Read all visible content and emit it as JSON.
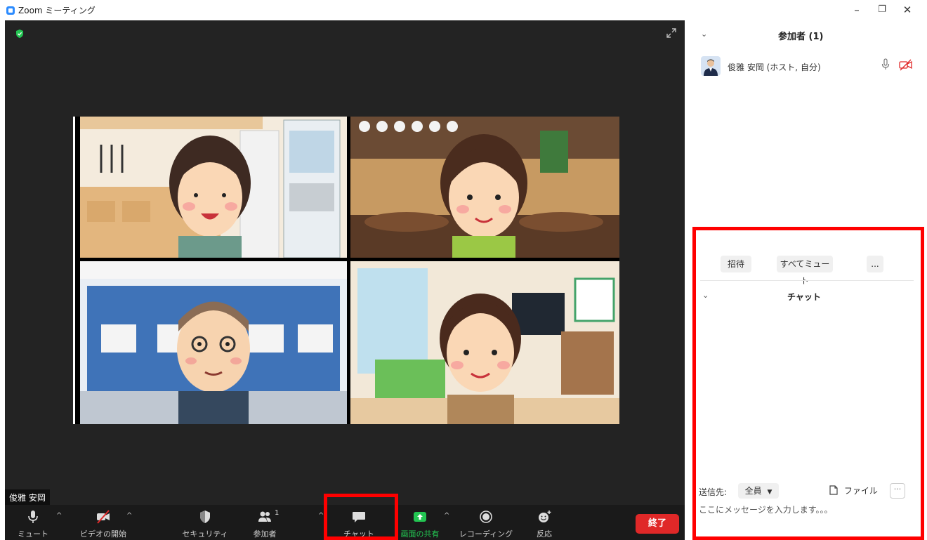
{
  "window": {
    "title": "Zoom ミーティング",
    "controls": {
      "minimize": "–",
      "restore": "❐",
      "close": "✕"
    }
  },
  "video": {
    "self_name_label": "俊雅 安岡",
    "participants_shown": 4
  },
  "toolbar": {
    "mute": "ミュート",
    "video": "ビデオの開始",
    "security": "セキュリティ",
    "participants": "参加者",
    "participants_count": "1",
    "chat": "チャット",
    "share": "画面の共有",
    "record": "レコーディング",
    "reactions": "反応",
    "end": "終了"
  },
  "participants_panel": {
    "title": "参加者 (1)",
    "participants": [
      {
        "name": "俊雅 安岡 (ホスト, 自分)",
        "mic": "on",
        "video": "off"
      }
    ],
    "invite": "招待",
    "mute_all": "すべてミュート",
    "more": "..."
  },
  "chat_panel": {
    "title": "チャット",
    "send_to_label": "送信先:",
    "send_to_value": "全員",
    "file_label": "ファイル",
    "more": "···",
    "input_placeholder": "ここにメッセージを入力します。。。"
  },
  "colors": {
    "accent_blue": "#2D8CFF",
    "end_red": "#E02828",
    "share_green": "#23C552",
    "highlight_red": "#FF0000",
    "video_bg": "#232323"
  }
}
